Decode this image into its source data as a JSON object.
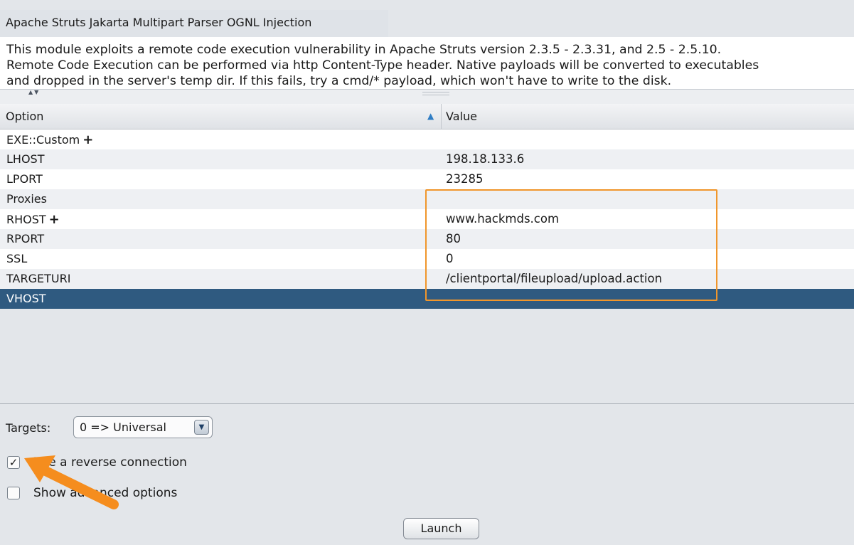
{
  "module": {
    "title": "Apache Struts Jakarta Multipart Parser OGNL Injection",
    "description_lines": [
      "This module exploits a remote code execution vulnerability in Apache Struts version 2.3.5 - 2.3.31, and 2.5 - 2.5.10.",
      "Remote Code Execution can be performed via http Content-Type header. Native payloads will be converted to executables",
      "and dropped in the server's temp dir. If this fails, try a cmd/* payload, which won't have to write to the disk."
    ]
  },
  "table": {
    "headers": {
      "option": "Option",
      "value": "Value"
    },
    "sort_icon": "sort-ascending-icon",
    "rows": [
      {
        "option": "EXE::Custom",
        "value": "",
        "plus": true
      },
      {
        "option": "LHOST",
        "value": "198.18.133.6",
        "plus": false
      },
      {
        "option": "LPORT",
        "value": "23285",
        "plus": false
      },
      {
        "option": "Proxies",
        "value": "",
        "plus": false
      },
      {
        "option": "RHOST",
        "value": "www.hackmds.com",
        "plus": true
      },
      {
        "option": "RPORT",
        "value": "80",
        "plus": false
      },
      {
        "option": "SSL",
        "value": "0",
        "plus": false
      },
      {
        "option": "TARGETURI",
        "value": "/clientportal/fileupload/upload.action",
        "plus": false
      },
      {
        "option": "VHOST",
        "value": "",
        "plus": false,
        "selected": true
      }
    ]
  },
  "targets": {
    "label": "Targets:",
    "selected": "0 => Universal"
  },
  "checkboxes": {
    "reverse": {
      "label": "Use a reverse connection",
      "checked": true
    },
    "advanced": {
      "label": "Show advanced options",
      "checked": false
    }
  },
  "launch_label": "Launch",
  "colors": {
    "selected_row": "#2f5a80",
    "highlight_annotation": "#f0962b",
    "arrow_annotation": "#f58d1e"
  }
}
